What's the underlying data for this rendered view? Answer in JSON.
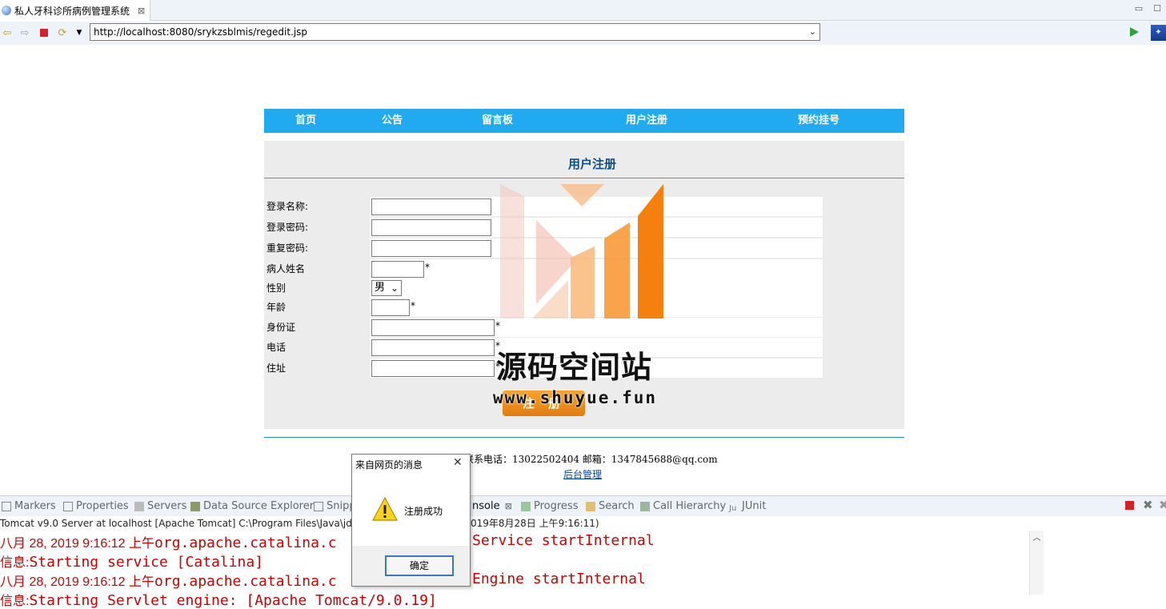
{
  "browser": {
    "tab_title": "私人牙科诊所病例管理系统",
    "tab_close": "⊠",
    "url": "http://localhost:8080/srykzsblmis/regedit.jsp"
  },
  "menu": {
    "items": [
      "首页",
      "公告",
      "留言板",
      "用户注册",
      "预约挂号"
    ]
  },
  "form": {
    "title": "用户注册",
    "fields": [
      {
        "label": "登录名称:",
        "required": ""
      },
      {
        "label": "登录密码:",
        "required": ""
      },
      {
        "label": "重复密码:",
        "required": ""
      },
      {
        "label": "病人姓名",
        "required": "*"
      },
      {
        "label": "性别",
        "value": "男"
      },
      {
        "label": "年龄",
        "required": "*"
      },
      {
        "label": "身份证",
        "required": "*"
      },
      {
        "label": "电话",
        "required": "*"
      },
      {
        "label": "住址",
        "required": "*"
      }
    ],
    "submit_label": "注 册"
  },
  "footer": {
    "contact": "联系电话：13022502404 邮箱：1347845688@qq.com",
    "admin_link": "后台管理"
  },
  "watermark": {
    "text": "源码空间站",
    "url": "www.shuyue.fun"
  },
  "views": {
    "tabs": [
      "Markers",
      "Properties",
      "Servers",
      "Data Source Explorer",
      "Snipp",
      "nsole",
      "Progress",
      "Search",
      "Call Hierarchy",
      "JUnit"
    ],
    "console_close": "⊠"
  },
  "console": {
    "server_line_left": "Tomcat v9.0 Server at localhost [Apache Tomcat] C:\\Program Files\\Java\\jdk1",
    "server_line_right": "019年8月28日 上午9:16:11)",
    "lines": [
      {
        "prefix": "八月 28, 2019 9:16:12 上午",
        "left": "org.apache.catalina.c",
        "right": "Service startInternal"
      },
      {
        "prefix": "信息:",
        "left": "Starting service [Catalina]",
        "right": ""
      },
      {
        "prefix": "八月 28, 2019 9:16:12 上午",
        "left": "org.apache.catalina.c",
        "right": "Engine startInternal"
      },
      {
        "prefix": "信息:",
        "left": "Starting Servlet engine: [Apache Tomcat/9.0.19]",
        "right": ""
      }
    ]
  },
  "dialog": {
    "title": "来自网页的消息",
    "message": "注册成功",
    "ok_label": "确定"
  }
}
